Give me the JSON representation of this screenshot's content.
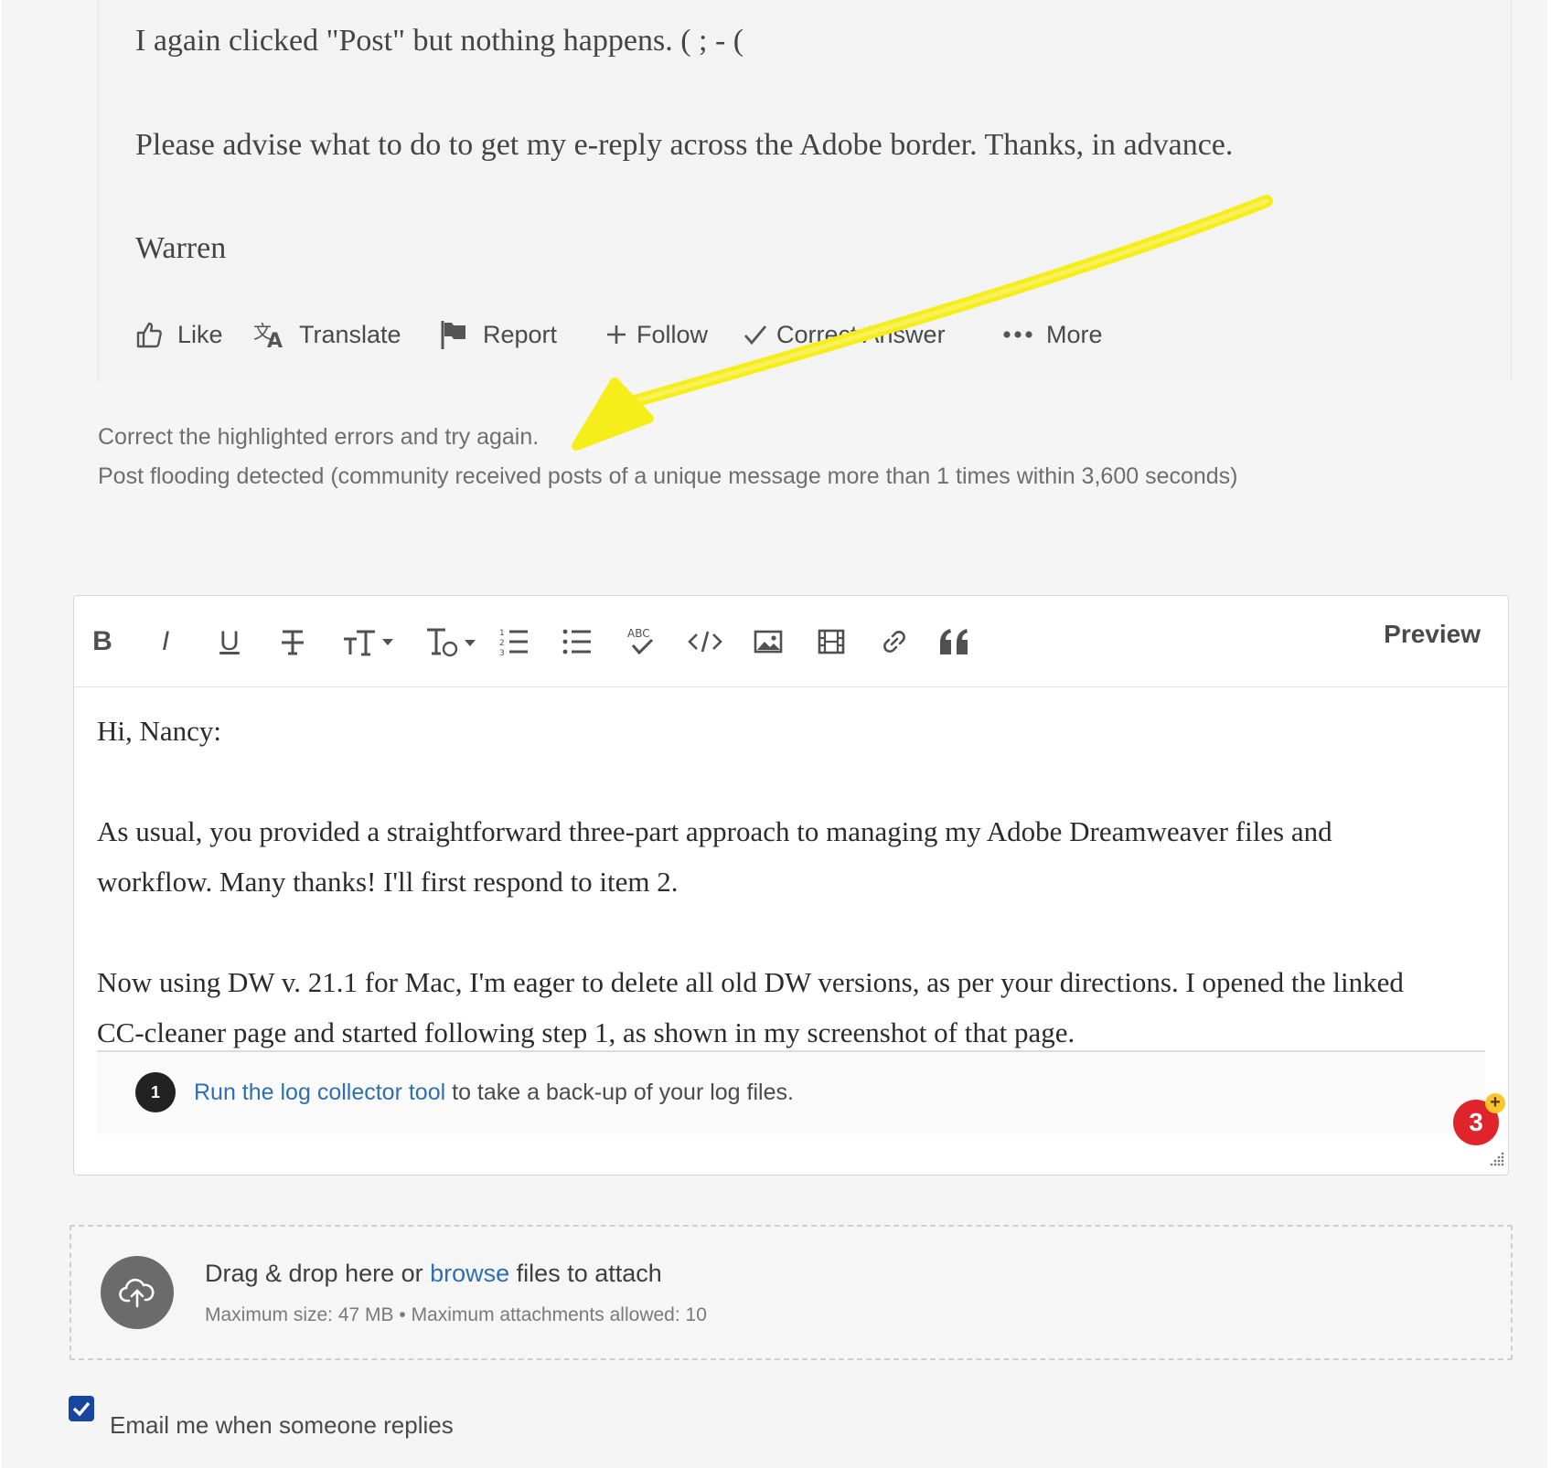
{
  "post": {
    "paragraphs": [
      "I again clicked \"Post\" but nothing happens.   (  ; - (",
      "Please advise what to do to get my e-reply across the Adobe border. Thanks, in advance.",
      "Warren"
    ],
    "actions": {
      "like": "Like",
      "translate": "Translate",
      "report": "Report",
      "follow": "Follow",
      "correct_answer": "Correct Answer",
      "more": "More"
    }
  },
  "errors": {
    "line1": "Correct the highlighted errors and try again.",
    "line2": "Post flooding detected (community received posts of a unique message more than 1 times within 3,600 seconds)"
  },
  "annotation": {
    "arrow_color": "#f5ee1a"
  },
  "editor": {
    "toolbar": {
      "bold": "B",
      "italic": "I",
      "underline": "U",
      "preview": "Preview",
      "icons": [
        "bold-icon",
        "italic-icon",
        "underline-icon",
        "strikethrough-icon",
        "font-size-icon",
        "text-style-icon",
        "numbered-list-icon",
        "bulleted-list-icon",
        "spellcheck-icon",
        "code-icon",
        "image-icon",
        "video-icon",
        "link-icon",
        "quote-icon"
      ]
    },
    "content": {
      "greeting": "Hi, Nancy:",
      "para1_line1": "As usual, you provided a straightforward three-part approach to managing my Adobe Dreamweaver files and",
      "para1_line2": "workflow. Many thanks! I'll first respond to item 2.",
      "para2_line1": "Now using DW v. 21.1 for Mac, I'm eager to delete all old DW versions, as per your directions. I opened the linked",
      "para2_line2": "CC-cleaner page and started following step 1, as shown in my screenshot of that page.",
      "screenshot": {
        "step_number": "1",
        "link_text": "Run the log collector tool",
        "rest_text": " to take a back-up of your log files."
      }
    },
    "grammar_badge": {
      "count": "3",
      "plus": "+",
      "color": "#e0242c"
    }
  },
  "attach": {
    "prefix": "Drag & drop here or ",
    "link": "browse",
    "suffix": " files to attach",
    "limits": "Maximum size: 47 MB • Maximum attachments allowed: 10"
  },
  "email_notify": {
    "label": "Email me when someone replies",
    "checked": true
  },
  "colors": {
    "accent_link": "#2d6fb6",
    "checkbox": "#1746a2"
  }
}
